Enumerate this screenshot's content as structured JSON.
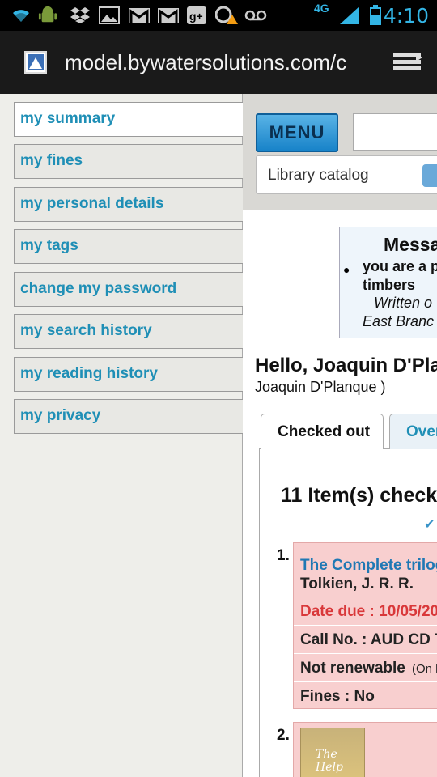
{
  "status_bar": {
    "time": "4:10",
    "network": "4G",
    "icons": [
      "wifi-icon",
      "android-icon",
      "dropbox-icon",
      "gallery-icon",
      "gmail-icon",
      "gmail-icon",
      "google-plus-icon",
      "download-warning-icon",
      "voicemail-icon",
      "signal-icon",
      "battery-icon"
    ]
  },
  "browser": {
    "url": "model.bywatersolutions.com/c"
  },
  "sidebar": {
    "items": [
      {
        "label": "my summary",
        "active": true
      },
      {
        "label": "my fines"
      },
      {
        "label": "my personal details"
      },
      {
        "label": "my tags"
      },
      {
        "label": "change my password"
      },
      {
        "label": "my search history"
      },
      {
        "label": "my reading history"
      },
      {
        "label": "my privacy"
      }
    ]
  },
  "header": {
    "menu_label": "MENU",
    "catalog_select": "Library catalog"
  },
  "messages": {
    "title": "Messa",
    "line1": "you are a p",
    "line2": "timbers",
    "line3": "Written o",
    "line4": "East Branc"
  },
  "greeting": "Hello, Joaquin D'Pla",
  "username": "Joaquin D'Planque )",
  "tabs": [
    {
      "label": "Checked out"
    },
    {
      "label": "Over"
    }
  ],
  "summary": {
    "count_text": "11 Item(s) check"
  },
  "items": [
    {
      "number": "1.",
      "title": "The Complete trilog",
      "author": "Tolkien, J. R. R.",
      "date_due": "Date due : 10/05/20",
      "call_no": "Call No. : AUD CD T",
      "renewable": "Not renewable",
      "renewable_note": "(On h",
      "fines": "Fines : No"
    },
    {
      "number": "2.",
      "cover_text": "The Help"
    }
  ],
  "colors": {
    "link": "#1f8fb6",
    "due": "#d9383a",
    "item_bg": "#f8cfcf"
  }
}
